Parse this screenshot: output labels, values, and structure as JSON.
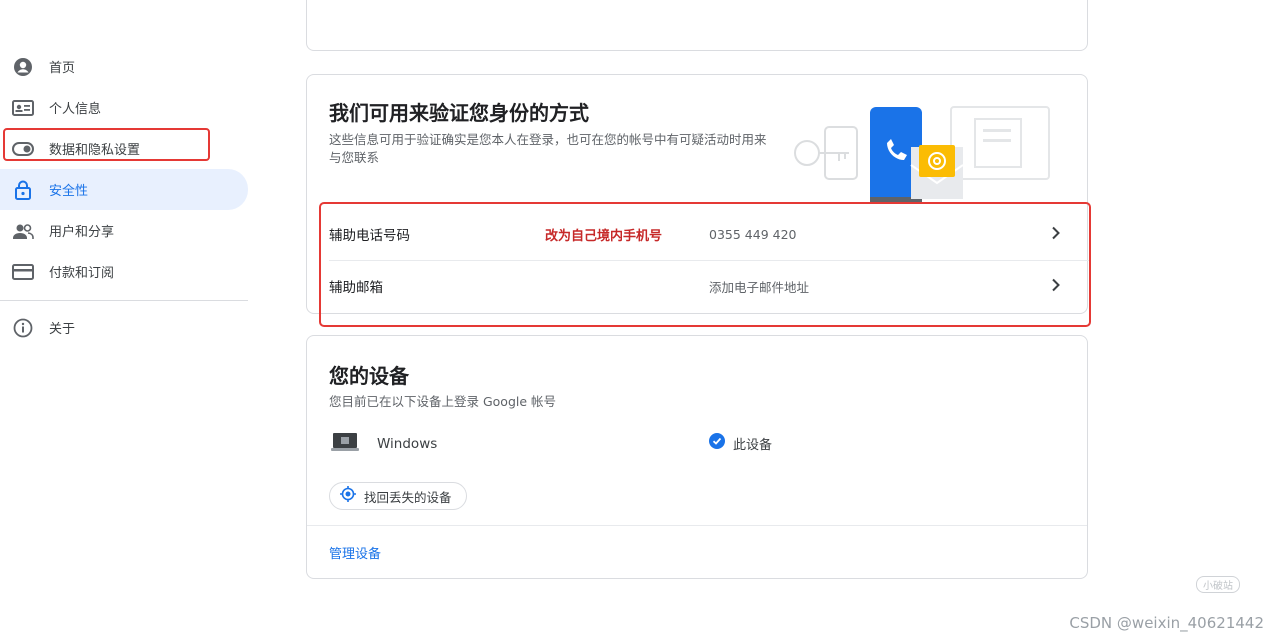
{
  "sidebar": {
    "items": [
      {
        "label": "首页",
        "icon": "account-circle-icon"
      },
      {
        "label": "个人信息",
        "icon": "id-card-icon"
      },
      {
        "label": "数据和隐私设置",
        "icon": "toggle-icon"
      },
      {
        "label": "安全性",
        "icon": "lock-icon",
        "active": true
      },
      {
        "label": "用户和分享",
        "icon": "people-icon"
      },
      {
        "label": "付款和订阅",
        "icon": "credit-card-icon"
      }
    ],
    "about": {
      "label": "关于",
      "icon": "info-icon"
    }
  },
  "verify": {
    "title": "我们可用来验证您身份的方式",
    "description": "这些信息可用于验证确实是您本人在登录，也可在您的帐号中有可疑活动时用来与您联系",
    "rows": [
      {
        "label": "辅助电话号码",
        "annotation": "改为自己境内手机号",
        "value": "0355 449 420"
      },
      {
        "label": "辅助邮箱",
        "annotation": "",
        "value": "添加电子邮件地址"
      }
    ]
  },
  "devices": {
    "title": "您的设备",
    "description": "您目前已在以下设备上登录 Google 帐号",
    "device_name": "Windows",
    "this_device_label": "此设备",
    "find_device_label": "找回丢失的设备",
    "manage_label": "管理设备"
  },
  "watermark": {
    "text": "CSDN @weixin_40621442",
    "small": "小破站"
  },
  "colors": {
    "accent": "#1a73e8",
    "active_bg": "#e8f0fe",
    "annotation_red": "#e53935"
  }
}
